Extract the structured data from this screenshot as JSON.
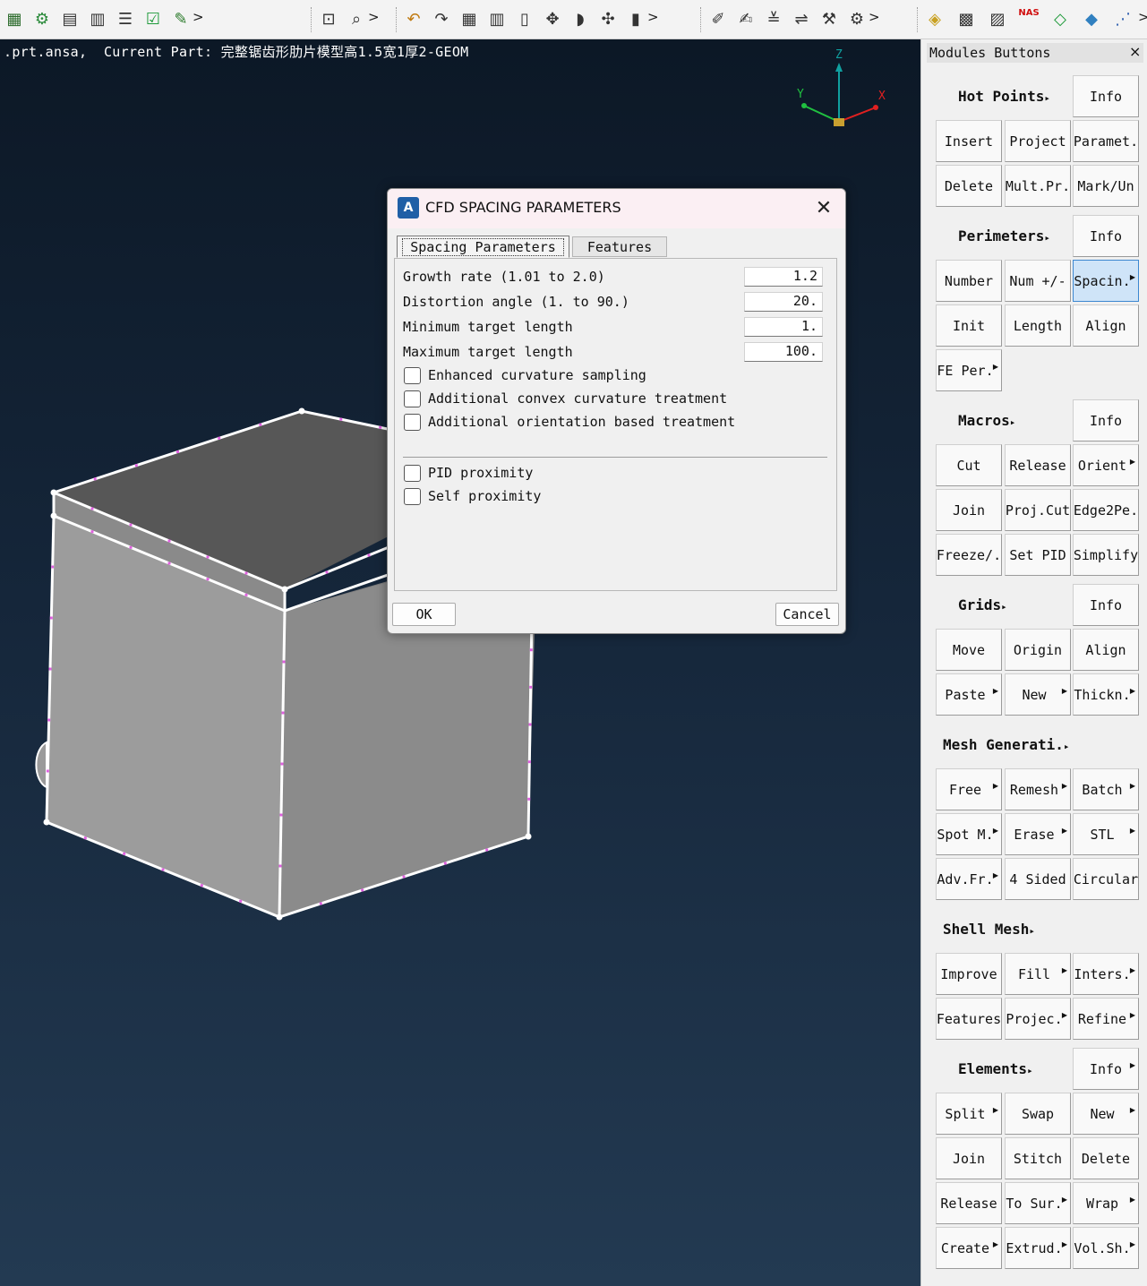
{
  "toolbar": {
    "groups": [
      {
        "icons": [
          "module-load-icon",
          "gear-part-icon",
          "part-manager-icon",
          "clipboard-icon",
          "list-icon",
          "check-icon",
          "brush-icon"
        ]
      },
      {
        "icons": [
          "zoom-window-icon",
          "zoom-icon"
        ]
      },
      {
        "icons": [
          "undo-icon",
          "redo-icon",
          "grid-icon",
          "measure-icon",
          "delete-icon",
          "move-icon",
          "shape-icon",
          "transform-icon",
          "ruler-icon"
        ]
      },
      {
        "icons": [
          "wrench-icon",
          "edit-icon",
          "align-icon",
          "swap-icon",
          "hammer-icon",
          "tool-icon"
        ]
      },
      {
        "icons": [
          "visibility-icon",
          "wireframe-icon",
          "shaded-icon",
          "nas-deck-icon",
          "mesh-icon",
          "elements-icon",
          "connections-icon"
        ]
      }
    ],
    "more_glyph": ">",
    "nas_label": "NAS"
  },
  "viewport": {
    "status_text": ".prt.ansa,  Current Part: 完整锯齿形肋片模型高1.5宽1厚2-GEOM",
    "axis": {
      "x_label": "X",
      "y_label": "Y",
      "z_label": "Z"
    }
  },
  "dialog": {
    "title": "CFD SPACING PARAMETERS",
    "logo_text": "A",
    "close_glyph": "✕",
    "tabs": [
      {
        "label": "Spacing Parameters",
        "active": true
      },
      {
        "label": "Features",
        "active": false
      }
    ],
    "params": [
      {
        "label": "Growth rate (1.01 to 2.0)",
        "value": "1.2"
      },
      {
        "label": "Distortion angle (1. to 90.)",
        "value": "20."
      },
      {
        "label": "Minimum target length",
        "value": "1."
      },
      {
        "label": "Maximum target length",
        "value": "100."
      }
    ],
    "checks_a": [
      {
        "label": "Enhanced curvature sampling",
        "checked": false
      },
      {
        "label": "Additional convex curvature treatment",
        "checked": false
      },
      {
        "label": "Additional orientation based treatment",
        "checked": false
      }
    ],
    "checks_b": [
      {
        "label": "PID proximity",
        "checked": false
      },
      {
        "label": "Self proximity",
        "checked": false
      }
    ],
    "ok_label": "OK",
    "cancel_label": "Cancel"
  },
  "modules": {
    "title": "Modules Buttons",
    "close_glyph": "×",
    "sections": [
      {
        "header": "Hot Points",
        "header_arrow": true,
        "header_info": "Info",
        "info_arrow": false,
        "buttons": [
          [
            "Insert",
            false
          ],
          [
            "Project",
            false
          ],
          [
            "Paramet.",
            false
          ],
          [
            "Delete",
            false
          ],
          [
            "Mult.Pr.",
            false
          ],
          [
            "Mark/Un",
            false
          ]
        ]
      },
      {
        "header": "Perimeters",
        "header_arrow": true,
        "header_info": "Info",
        "info_arrow": false,
        "buttons": [
          [
            "Number",
            false
          ],
          [
            "Num +/-",
            false
          ],
          [
            "Spacin.",
            true
          ],
          [
            "Init",
            false
          ],
          [
            "Length",
            false
          ],
          [
            "Align",
            false
          ],
          [
            "FE Per.",
            true
          ]
        ]
      },
      {
        "header": "Macros",
        "header_arrow": true,
        "header_info": "Info",
        "info_arrow": false,
        "buttons": [
          [
            "Cut",
            false
          ],
          [
            "Release",
            false
          ],
          [
            "Orient",
            true
          ],
          [
            "Join",
            false
          ],
          [
            "Proj.Cut",
            false
          ],
          [
            "Edge2Pe.",
            false
          ],
          [
            "Freeze/.",
            false
          ],
          [
            "Set PID",
            false
          ],
          [
            "Simplify",
            false
          ]
        ]
      },
      {
        "header": "Grids",
        "header_arrow": true,
        "header_info": "Info",
        "info_arrow": false,
        "buttons": [
          [
            "Move",
            false
          ],
          [
            "Origin",
            false
          ],
          [
            "Align",
            false
          ],
          [
            "Paste",
            true
          ],
          [
            "New",
            true
          ],
          [
            "Thickn.",
            true
          ]
        ]
      },
      {
        "header": "Mesh Generati.",
        "header_arrow": true,
        "header_info": "",
        "info_arrow": false,
        "buttons": [
          [
            "Free",
            true
          ],
          [
            "Remesh",
            true
          ],
          [
            "Batch",
            true
          ],
          [
            "Spot M.",
            true
          ],
          [
            "Erase",
            true
          ],
          [
            "STL",
            true
          ],
          [
            "Adv.Fr.",
            true
          ],
          [
            "4 Sided",
            false
          ],
          [
            "Circular",
            false
          ]
        ]
      },
      {
        "header": "Shell Mesh",
        "header_arrow": true,
        "header_info": "",
        "info_arrow": false,
        "buttons": [
          [
            "Improve",
            false
          ],
          [
            "Fill",
            true
          ],
          [
            "Inters.",
            true
          ],
          [
            "Features",
            false
          ],
          [
            "Projec.",
            true
          ],
          [
            "Refine",
            true
          ]
        ]
      },
      {
        "header": "Elements",
        "header_arrow": true,
        "header_info": "Info",
        "info_arrow": true,
        "buttons": [
          [
            "Split",
            true
          ],
          [
            "Swap",
            false
          ],
          [
            "New",
            true
          ],
          [
            "Join",
            false
          ],
          [
            "Stitch",
            false
          ],
          [
            "Delete",
            false
          ],
          [
            "Release",
            false
          ],
          [
            "To Sur.",
            true
          ],
          [
            "Wrap",
            true
          ],
          [
            "Create",
            true
          ],
          [
            "Extrud.",
            true
          ],
          [
            "Vol.Sh.",
            true
          ]
        ]
      }
    ]
  },
  "colors": {
    "viewport_top": "#0c1826",
    "viewport_bottom": "#233a52",
    "active_button": "#cfe4f8",
    "axis_x": "#e02020",
    "axis_y": "#20c040",
    "axis_z": "#10a0a0",
    "perimeter_node": "#e060e0"
  }
}
